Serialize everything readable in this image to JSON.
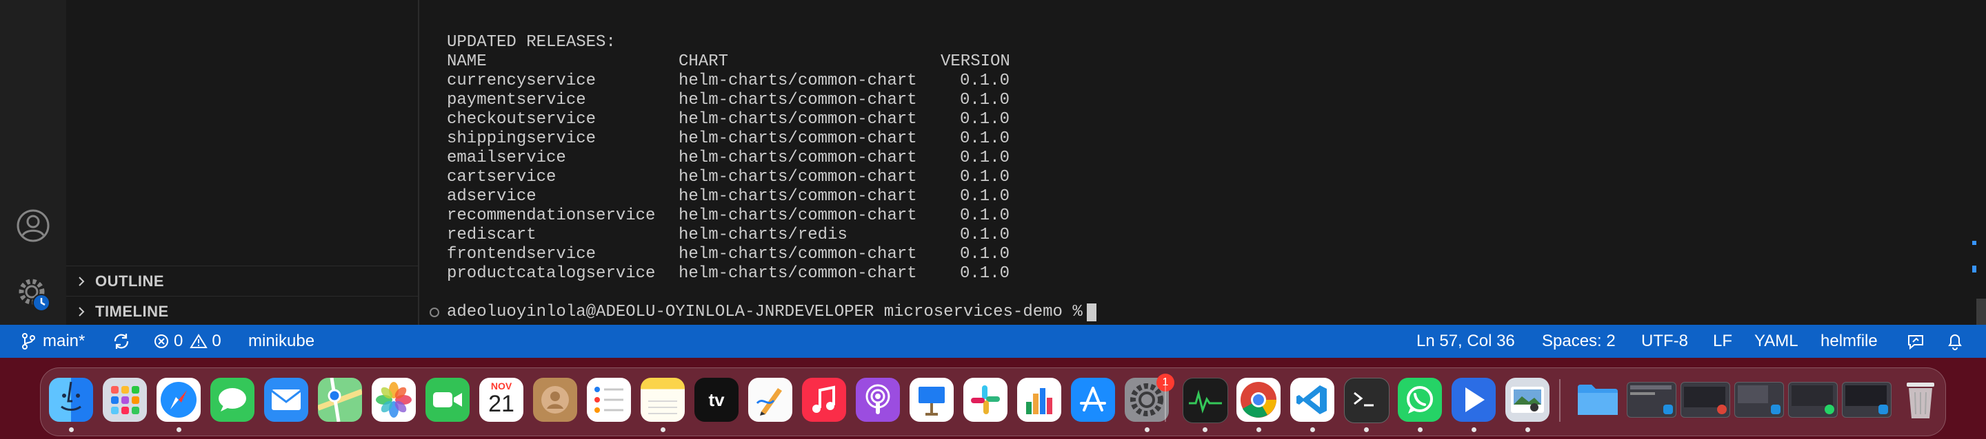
{
  "terminal": {
    "header": "UPDATED RELEASES:",
    "columns": {
      "name": "NAME",
      "chart": "CHART",
      "version": "VERSION"
    },
    "rows": [
      {
        "name": "currencyservice",
        "chart": "helm-charts/common-chart",
        "version": "0.1.0"
      },
      {
        "name": "paymentservice",
        "chart": "helm-charts/common-chart",
        "version": "0.1.0"
      },
      {
        "name": "checkoutservice",
        "chart": "helm-charts/common-chart",
        "version": "0.1.0"
      },
      {
        "name": "shippingservice",
        "chart": "helm-charts/common-chart",
        "version": "0.1.0"
      },
      {
        "name": "emailservice",
        "chart": "helm-charts/common-chart",
        "version": "0.1.0"
      },
      {
        "name": "cartservice",
        "chart": "helm-charts/common-chart",
        "version": "0.1.0"
      },
      {
        "name": "adservice",
        "chart": "helm-charts/common-chart",
        "version": "0.1.0"
      },
      {
        "name": "recommendationservice",
        "chart": "helm-charts/common-chart",
        "version": "0.1.0"
      },
      {
        "name": "rediscart",
        "chart": "helm-charts/redis",
        "version": "0.1.0"
      },
      {
        "name": "frontendservice",
        "chart": "helm-charts/common-chart",
        "version": "0.1.0"
      },
      {
        "name": "productcatalogservice",
        "chart": "helm-charts/common-chart",
        "version": "0.1.0"
      }
    ],
    "prompt": "adeoluoyinlola@ADEOLU-OYINLOLA-JNRDEVELOPER microservices-demo %"
  },
  "sidebar": {
    "sections": [
      {
        "label": "OUTLINE"
      },
      {
        "label": "TIMELINE"
      }
    ]
  },
  "statusbar": {
    "branch": "main*",
    "errors": "0",
    "warnings": "0",
    "context": "minikube",
    "cursor_position": "Ln 57, Col 36",
    "indentation": "Spaces: 2",
    "encoding": "UTF-8",
    "eol": "LF",
    "language": "YAML",
    "file_type": "helmfile"
  },
  "dock": {
    "calendar_month": "NOV",
    "calendar_day": "21",
    "tv_label": "tv",
    "settings_badge": "1",
    "apps": [
      {
        "name": "Finder",
        "icon": "finder-icon",
        "color": "#1e7cf2"
      },
      {
        "name": "Launchpad",
        "icon": "launchpad-icon",
        "color": "#9aa0b0"
      },
      {
        "name": "Safari",
        "icon": "safari-icon",
        "color": "#1f8fff"
      },
      {
        "name": "Messages",
        "icon": "messages-icon",
        "color": "#34c759"
      },
      {
        "name": "Mail",
        "icon": "mail-icon",
        "color": "#2b8cf6"
      },
      {
        "name": "Maps",
        "icon": "maps-icon",
        "color": "#58b66b"
      },
      {
        "name": "Photos",
        "icon": "photos-icon",
        "color": "#f2f2f2"
      },
      {
        "name": "FaceTime",
        "icon": "facetime-icon",
        "color": "#32c255"
      },
      {
        "name": "Calendar",
        "icon": "calendar-icon",
        "color": "#ffffff"
      },
      {
        "name": "Contacts",
        "icon": "contacts-icon",
        "color": "#b98a55"
      },
      {
        "name": "Reminders",
        "icon": "reminders-icon",
        "color": "#ffffff"
      },
      {
        "name": "Notes",
        "icon": "notes-icon",
        "color": "#fbd44a"
      },
      {
        "name": "TV",
        "icon": "appletv-icon",
        "color": "#111111"
      },
      {
        "name": "Freeform",
        "icon": "freeform-icon",
        "color": "#f7f7f7"
      },
      {
        "name": "Music",
        "icon": "music-icon",
        "color": "#fa2d48"
      },
      {
        "name": "Podcasts",
        "icon": "podcasts-icon",
        "color": "#9b4de0"
      },
      {
        "name": "Keynote",
        "icon": "keynote-icon",
        "color": "#ffffff"
      },
      {
        "name": "Slack",
        "icon": "slack-icon",
        "color": "#ffffff"
      },
      {
        "name": "Numbers",
        "icon": "numbers-icon",
        "color": "#ffffff"
      },
      {
        "name": "App Store",
        "icon": "appstore-icon",
        "color": "#1a8cff"
      },
      {
        "name": "System Settings",
        "icon": "settings-icon",
        "color": "#8e8e93"
      },
      {
        "name": "Activity Monitor",
        "icon": "activity-monitor-icon",
        "color": "#1b1b1b"
      },
      {
        "name": "Chrome",
        "icon": "chrome-icon",
        "color": "#ffffff"
      },
      {
        "name": "VS Code",
        "icon": "vscode-icon",
        "color": "#ffffff"
      },
      {
        "name": "Terminal",
        "icon": "terminal-icon",
        "color": "#2b2b2b"
      },
      {
        "name": "WhatsApp",
        "icon": "whatsapp-icon",
        "color": "#25d366"
      },
      {
        "name": "Prime Video",
        "icon": "video-player-icon",
        "color": "#2b6de5"
      },
      {
        "name": "Preview",
        "icon": "preview-icon",
        "color": "#d8dde5"
      },
      {
        "name": "Downloads",
        "icon": "folder-icon",
        "color": "#3b9cf0"
      },
      {
        "name": "Trash",
        "icon": "trash-icon",
        "color": "#d9d9d9"
      }
    ]
  }
}
